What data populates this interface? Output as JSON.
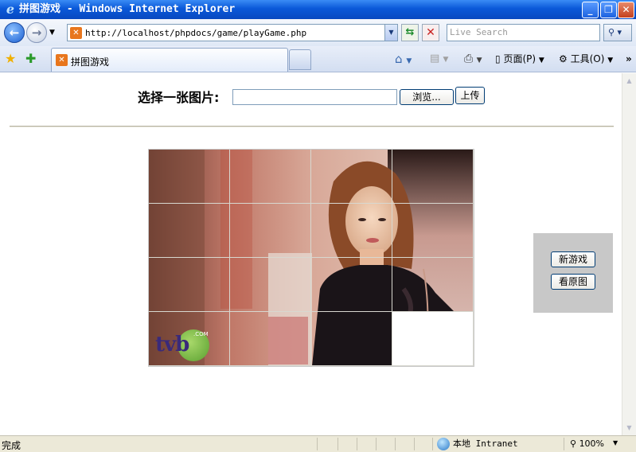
{
  "window": {
    "title": "拼图游戏 - Windows Internet Explorer",
    "minimize": "_",
    "maximize": "❐",
    "close": "✕"
  },
  "address_bar": {
    "url": "http://localhost/phpdocs/game/playGame.php",
    "search_placeholder": "Live Search"
  },
  "tab": {
    "label": "拼图游戏"
  },
  "command_bar": {
    "page_label": "页面(P)",
    "tools_label": "工具(O)"
  },
  "page": {
    "upload_label": "选择一张图片:",
    "browse_button": "浏览...",
    "upload_button": "上传",
    "new_game_button": "新游戏",
    "view_original_button": "看原图",
    "logo_text": "tvb",
    "logo_sub": ".COM"
  },
  "puzzle": {
    "rows": 4,
    "cols": 4,
    "empty_tile": {
      "row": 3,
      "col": 3
    }
  },
  "status_bar": {
    "status_text": "完成",
    "zone_text": "本地 Intranet",
    "zoom_text": "100%"
  }
}
